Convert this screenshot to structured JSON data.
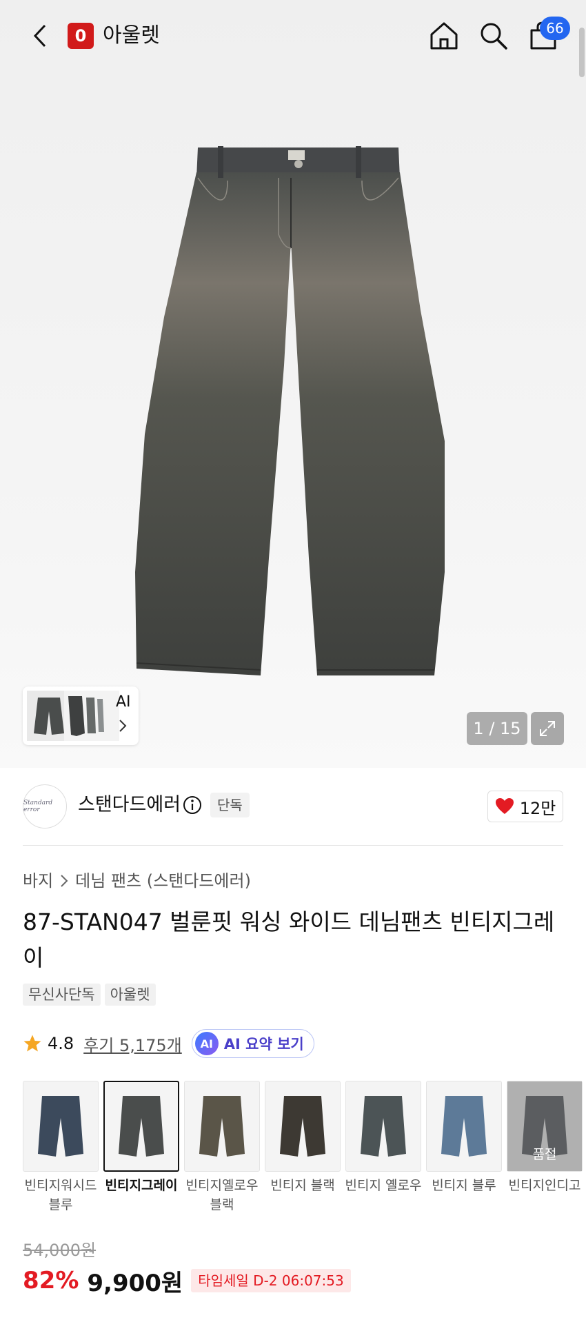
{
  "header": {
    "logo_letter": "0",
    "title": "아울렛",
    "cart_count": "66",
    "icons": [
      "back-icon",
      "home-icon",
      "search-icon",
      "cart-icon"
    ]
  },
  "gallery": {
    "thumb_label": "AI",
    "counter": "1 / 15"
  },
  "store": {
    "avatar_text": "Standard error",
    "name": "스탠다드에러",
    "badge": "단독",
    "likes": "12만",
    "heart_color": "#e31b23"
  },
  "breadcrumb": {
    "category": "바지",
    "subcategory": "데님 팬츠 (스탠다드에러)"
  },
  "product": {
    "title": "87-STAN047 벌룬핏 워싱 와이드 데님팬츠 빈티지그레이",
    "tags": [
      "무신사단독",
      "아울렛"
    ],
    "rating": "4.8",
    "reviews": "후기 5,175개",
    "ai_badge": "AI",
    "ai_summary": "AI 요약 보기"
  },
  "options": [
    {
      "label": "빈티지워시드 블루",
      "selected": false,
      "color": "#3c4a5c"
    },
    {
      "label": "빈티지그레이",
      "selected": true,
      "color": "#4a4d4c"
    },
    {
      "label": "빈티지옐로우 블랙",
      "selected": false,
      "color": "#5a5548"
    },
    {
      "label": "빈티지 블랙",
      "selected": false,
      "color": "#3d3933"
    },
    {
      "label": "빈티지 옐로우",
      "selected": false,
      "color": "#4c5456"
    },
    {
      "label": "빈티지 블루",
      "selected": false,
      "color": "#5d7a98"
    },
    {
      "label": "빈티지인디고",
      "selected": false,
      "color": "#383d44",
      "soldout_text": "품절"
    }
  ],
  "price": {
    "original": "54,000원",
    "discount": "82%",
    "sale": "9,900원",
    "timesale": "타임세일 D-2 06:07:53",
    "accent_color": "#e31b23"
  }
}
